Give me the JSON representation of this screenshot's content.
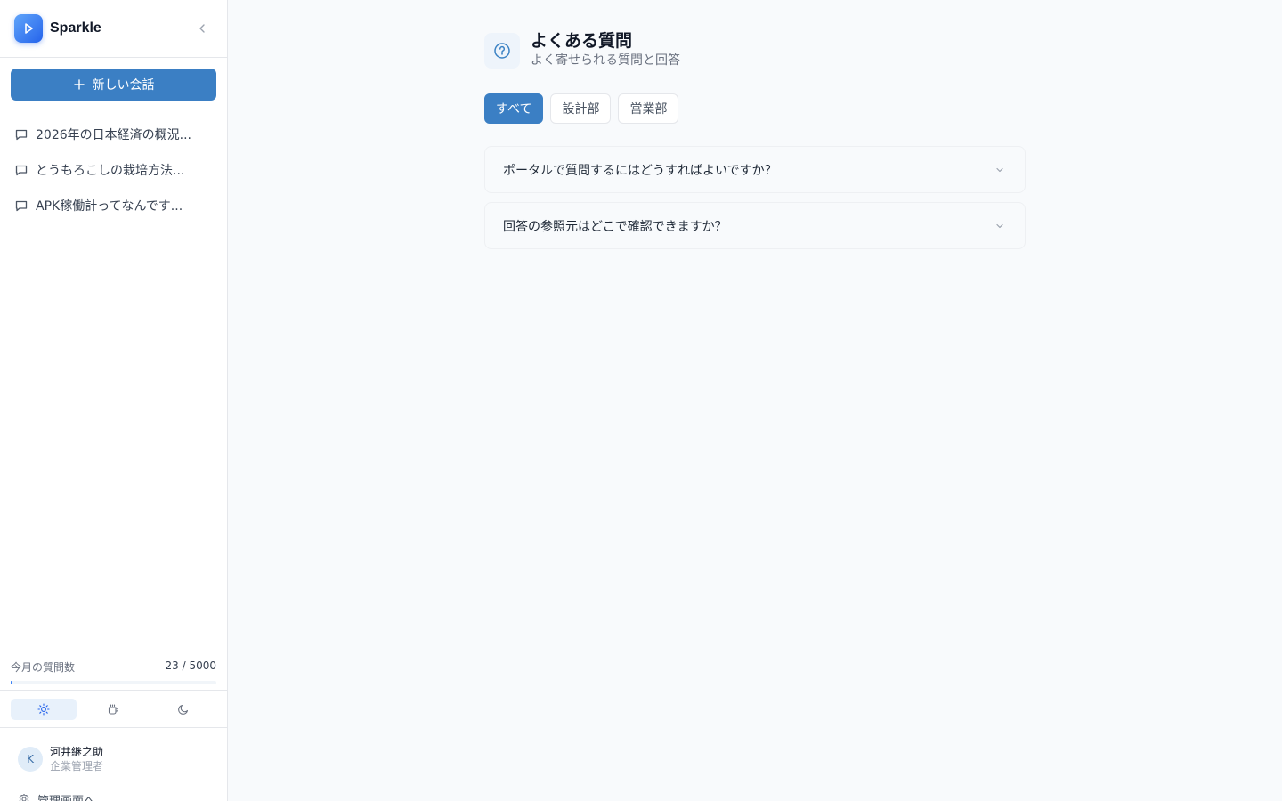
{
  "app": {
    "name": "Sparkle"
  },
  "sidebar": {
    "new_chat_label": "新しい会話",
    "conversations": [
      {
        "title": "2026年の日本経済の概況..."
      },
      {
        "title": "とうもろこしの栽培方法..."
      },
      {
        "title": "APK稼働計ってなんです..."
      }
    ],
    "usage": {
      "label": "今月の質問数",
      "value_text": "23 / 5000",
      "used": 23,
      "limit": 5000
    },
    "theme": {
      "options": [
        "light",
        "warm",
        "dark"
      ],
      "selected": "light"
    },
    "user": {
      "initial": "K",
      "name": "河井継之助",
      "role": "企業管理者"
    },
    "admin_link_label": "管理画面へ"
  },
  "main": {
    "title": "よくある質問",
    "subtitle": "よく寄せられる質問と回答",
    "tabs": [
      {
        "label": "すべて",
        "active": true
      },
      {
        "label": "設計部",
        "active": false
      },
      {
        "label": "営業部",
        "active": false
      }
    ],
    "faqs": [
      {
        "question": "ポータルで質問するにはどうすればよいですか？"
      },
      {
        "question": "回答の参照元はどこで確認できますか？"
      }
    ]
  },
  "colors": {
    "accent": "#3b7fc4",
    "logo_gradient_start": "#60a5fa",
    "logo_gradient_end": "#2563eb"
  }
}
